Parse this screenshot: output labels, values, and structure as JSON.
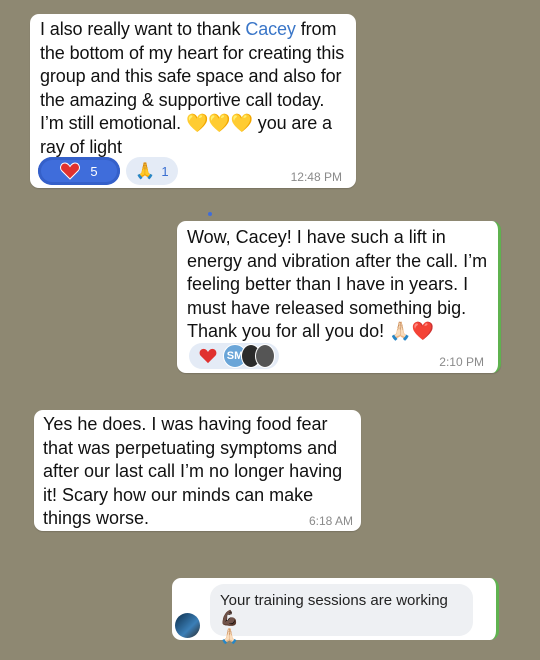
{
  "messages": [
    {
      "text_before": "I also really want to thank ",
      "mention": "Cacey",
      "text_after": " from the bottom of my heart for creating this group and this safe space and also for the amazing & supportive call today. I’m still emotional. ",
      "emoji": "💛💛💛",
      "text_end": " you are a ray of light",
      "reactions": [
        {
          "emoji": "❤️",
          "count": "5"
        },
        {
          "emoji": "🙏",
          "count": "1"
        }
      ],
      "time": "12:48 PM"
    },
    {
      "text": "Wow, Cacey! I have such a lift in energy and vibration after the call. I’m feeling better than I have in years. I must have released something big. Thank you for all you do! ",
      "emoji": "🙏🏻❤️",
      "reaction_emoji": "❤️",
      "reactor_initials": "SM",
      "time": "2:10 PM"
    },
    {
      "text": "Yes he does. I was having food fear that was perpetuating symptoms and after our last call I’m no longer having it! Scary how our minds can make things worse.",
      "time": "6:18 AM"
    },
    {
      "text": "Your training sessions are working ",
      "emoji": "💪🏿",
      "emoji2": "🙏🏻"
    }
  ],
  "colors": {
    "background": "#8e8872",
    "bubble": "#ffffff",
    "mention": "#3a76c8",
    "reaction_active": "#3f6ddb",
    "outgoing_edge": "#5fb24f"
  }
}
